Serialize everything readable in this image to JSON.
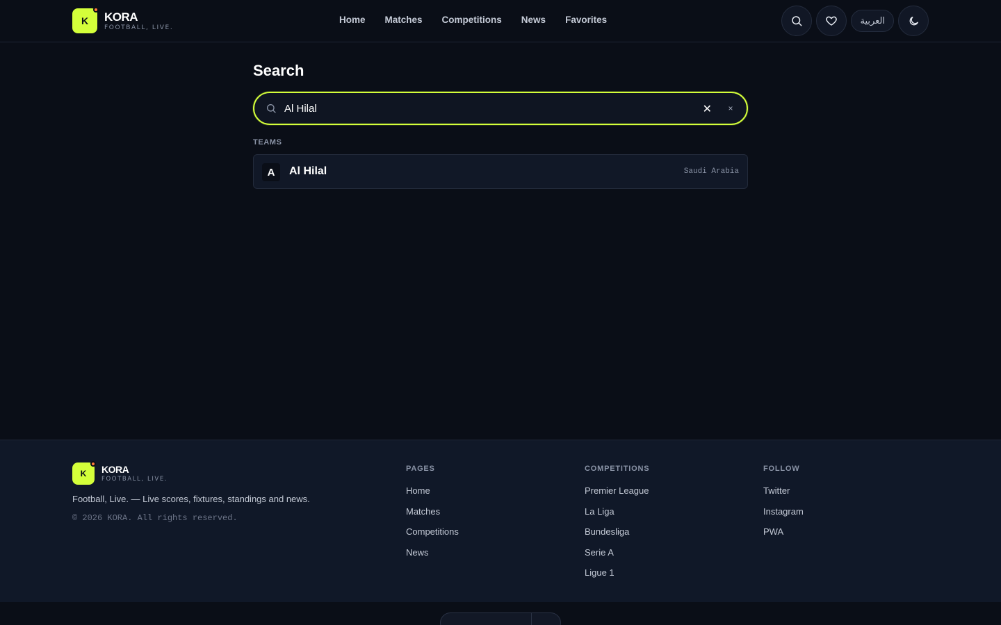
{
  "brand": {
    "letter": "K",
    "name": "KORA",
    "tagline": "FOOTBALL, LIVE."
  },
  "nav": [
    "Home",
    "Matches",
    "Competitions",
    "News",
    "Favorites"
  ],
  "header_actions": {
    "language": "العربية",
    "icons": [
      "search-icon",
      "heart-icon",
      "moon-icon"
    ]
  },
  "search": {
    "title": "Search",
    "query": "Al Hilal",
    "clear_main": "✕",
    "clear_small": "×"
  },
  "results": {
    "section_label": "TEAMS",
    "teams": [
      {
        "avatar": "A",
        "name": "Al Hilal",
        "country": "Saudi Arabia"
      }
    ]
  },
  "footer": {
    "description": "Football, Live. — Live scores, fixtures, standings and news.",
    "copyright": "© 2026 KORA. All rights reserved.",
    "columns": [
      {
        "title": "PAGES",
        "links": [
          "Home",
          "Matches",
          "Competitions",
          "News"
        ]
      },
      {
        "title": "COMPETITIONS",
        "links": [
          "Premier League",
          "La Liga",
          "Bundesliga",
          "Serie A",
          "Ligue 1"
        ]
      },
      {
        "title": "FOLLOW",
        "links": [
          "Twitter",
          "Instagram",
          "PWA"
        ]
      }
    ]
  },
  "colors": {
    "accent": "#d4ff3a",
    "background": "#0a0e17",
    "footer_bg": "#101828"
  }
}
